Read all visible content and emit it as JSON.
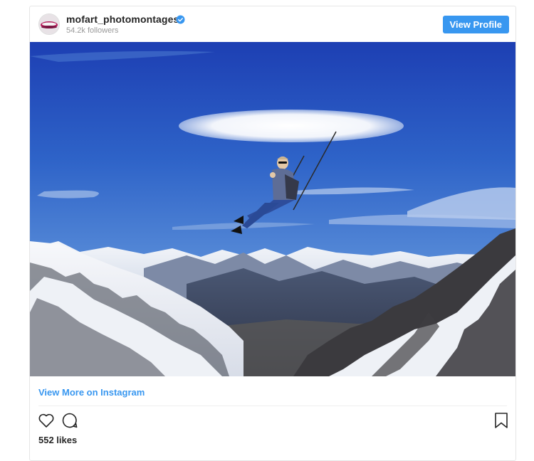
{
  "post": {
    "username": "mofart_photomontages",
    "followers": "54.2k followers",
    "verified_icon": "verified-badge-icon",
    "view_profile_label": "View Profile",
    "image_description_icon": "photo-image",
    "view_more_label": "View More on Instagram",
    "likes": "552 likes"
  },
  "icons": {
    "like": "heart-icon",
    "comment": "comment-icon",
    "save": "bookmark-icon"
  },
  "colors": {
    "accent": "#3897f0",
    "text": "#262626",
    "muted": "#999999"
  }
}
